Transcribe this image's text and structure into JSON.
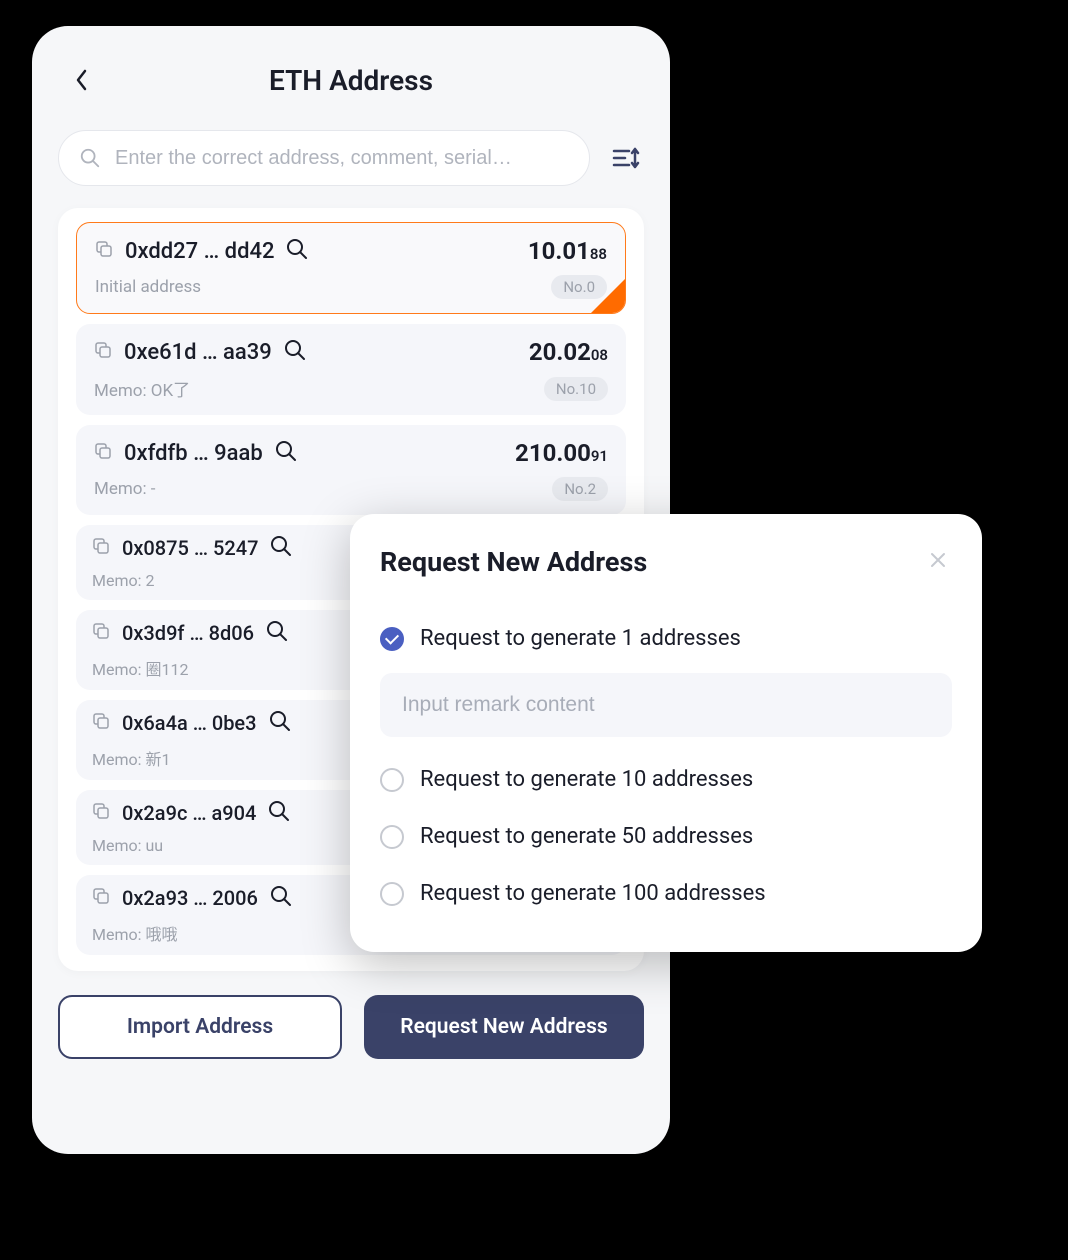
{
  "header": {
    "title": "ETH Address"
  },
  "search": {
    "placeholder": "Enter the correct address, comment, serial…"
  },
  "addresses": [
    {
      "addr": "0xdd27 … dd42",
      "balance_int": "10.01",
      "balance_dec": "88",
      "memo": "Initial address",
      "badge": "No.0",
      "selected": true
    },
    {
      "addr": "0xe61d … aa39",
      "balance_int": "20.02",
      "balance_dec": "08",
      "memo": "Memo: OK了",
      "badge": "No.10",
      "selected": false
    },
    {
      "addr": "0xfdfb … 9aab",
      "balance_int": "210.00",
      "balance_dec": "91",
      "memo": "Memo: -",
      "badge": "No.2",
      "selected": false
    },
    {
      "addr": "0x0875 … 5247",
      "memo": "Memo: 2"
    },
    {
      "addr": "0x3d9f … 8d06",
      "memo": "Memo: 圈112"
    },
    {
      "addr": "0x6a4a … 0be3",
      "memo": "Memo: 新1"
    },
    {
      "addr": "0x2a9c … a904",
      "memo": "Memo: uu"
    },
    {
      "addr": "0x2a93 … 2006",
      "memo": "Memo: 哦哦"
    }
  ],
  "buttons": {
    "import": "Import Address",
    "request": "Request New Address"
  },
  "modal": {
    "title": "Request New Address",
    "remark_placeholder": "Input remark content",
    "options": [
      {
        "label": "Request to generate 1 addresses",
        "checked": true,
        "has_remark": true
      },
      {
        "label": "Request to generate 10 addresses",
        "checked": false
      },
      {
        "label": "Request to generate 50 addresses",
        "checked": false
      },
      {
        "label": "Request to generate 100 addresses",
        "checked": false
      }
    ]
  }
}
